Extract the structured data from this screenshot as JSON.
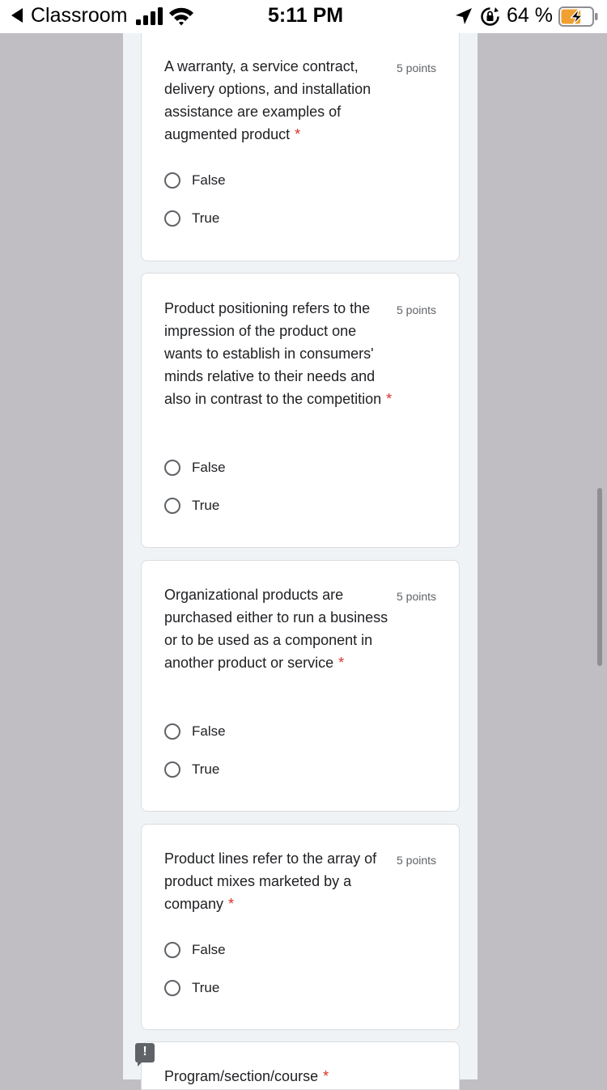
{
  "status_bar": {
    "back_app": "Classroom",
    "time": "5:11 PM",
    "battery_percent": "64 %",
    "battery_level": 0.64,
    "signal_bars": 4
  },
  "questions": [
    {
      "text": "A warranty, a service contract, delivery options, and installation assistance are examples of augmented product",
      "required": "*",
      "points": "5 points",
      "options": [
        "False",
        "True"
      ]
    },
    {
      "text": "Product positioning refers to the impression of the product one wants to establish in consumers' minds relative to their needs and also in contrast to the competition",
      "required": "*",
      "points": "5 points",
      "options": [
        "False",
        "True"
      ]
    },
    {
      "text": "Organizational products are purchased either to run a business or to be used as a component in another product or service",
      "required": "*",
      "points": "5 points",
      "options": [
        "False",
        "True"
      ]
    },
    {
      "text": "Product lines refer to the array of product mixes marketed by a company",
      "required": "*",
      "points": "5 points",
      "options": [
        "False",
        "True"
      ]
    }
  ],
  "last_field": {
    "label": "Program/section/course",
    "required": "*"
  },
  "icons": {
    "back": "back-arrow-icon",
    "signal": "cellular-signal-icon",
    "wifi": "wifi-icon",
    "location": "location-arrow-icon",
    "orientation_lock": "orientation-lock-icon",
    "battery": "battery-charging-icon",
    "feedback": "report-feedback-icon"
  },
  "colors": {
    "required_asterisk": "#d93025",
    "battery_fill": "#f0a030",
    "page_background": "#f0f3f5"
  }
}
